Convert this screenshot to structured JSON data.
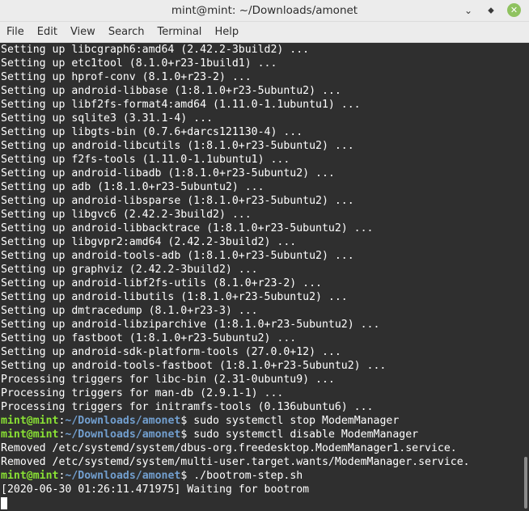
{
  "window": {
    "title": "mint@mint: ~/Downloads/amonet",
    "buttons": {
      "minimize": "⌄",
      "maximize": "⬥",
      "close": "✕"
    }
  },
  "menu": [
    "File",
    "Edit",
    "View",
    "Search",
    "Terminal",
    "Help"
  ],
  "prompt": {
    "user_host": "mint@mint",
    "path": "~/Downloads/amonet",
    "symbol": "$"
  },
  "lines": [
    {
      "type": "out",
      "text": "Setting up libcgraph6:amd64 (2.42.2-3build2) ..."
    },
    {
      "type": "out",
      "text": "Setting up etc1tool (8.1.0+r23-1build1) ..."
    },
    {
      "type": "out",
      "text": "Setting up hprof-conv (8.1.0+r23-2) ..."
    },
    {
      "type": "out",
      "text": "Setting up android-libbase (1:8.1.0+r23-5ubuntu2) ..."
    },
    {
      "type": "out",
      "text": "Setting up libf2fs-format4:amd64 (1.11.0-1.1ubuntu1) ..."
    },
    {
      "type": "out",
      "text": "Setting up sqlite3 (3.31.1-4) ..."
    },
    {
      "type": "out",
      "text": "Setting up libgts-bin (0.7.6+darcs121130-4) ..."
    },
    {
      "type": "out",
      "text": "Setting up android-libcutils (1:8.1.0+r23-5ubuntu2) ..."
    },
    {
      "type": "out",
      "text": "Setting up f2fs-tools (1.11.0-1.1ubuntu1) ..."
    },
    {
      "type": "out",
      "text": "Setting up android-libadb (1:8.1.0+r23-5ubuntu2) ..."
    },
    {
      "type": "out",
      "text": "Setting up adb (1:8.1.0+r23-5ubuntu2) ..."
    },
    {
      "type": "out",
      "text": "Setting up android-libsparse (1:8.1.0+r23-5ubuntu2) ..."
    },
    {
      "type": "out",
      "text": "Setting up libgvc6 (2.42.2-3build2) ..."
    },
    {
      "type": "out",
      "text": "Setting up android-libbacktrace (1:8.1.0+r23-5ubuntu2) ..."
    },
    {
      "type": "out",
      "text": "Setting up libgvpr2:amd64 (2.42.2-3build2) ..."
    },
    {
      "type": "out",
      "text": "Setting up android-tools-adb (1:8.1.0+r23-5ubuntu2) ..."
    },
    {
      "type": "out",
      "text": "Setting up graphviz (2.42.2-3build2) ..."
    },
    {
      "type": "out",
      "text": "Setting up android-libf2fs-utils (8.1.0+r23-2) ..."
    },
    {
      "type": "out",
      "text": "Setting up android-libutils (1:8.1.0+r23-5ubuntu2) ..."
    },
    {
      "type": "out",
      "text": "Setting up dmtracedump (8.1.0+r23-3) ..."
    },
    {
      "type": "out",
      "text": "Setting up android-libziparchive (1:8.1.0+r23-5ubuntu2) ..."
    },
    {
      "type": "out",
      "text": "Setting up fastboot (1:8.1.0+r23-5ubuntu2) ..."
    },
    {
      "type": "out",
      "text": "Setting up android-sdk-platform-tools (27.0.0+12) ..."
    },
    {
      "type": "out",
      "text": "Setting up android-tools-fastboot (1:8.1.0+r23-5ubuntu2) ..."
    },
    {
      "type": "out",
      "text": "Processing triggers for libc-bin (2.31-0ubuntu9) ..."
    },
    {
      "type": "out",
      "text": "Processing triggers for man-db (2.9.1-1) ..."
    },
    {
      "type": "out",
      "text": "Processing triggers for initramfs-tools (0.136ubuntu6) ..."
    },
    {
      "type": "cmd",
      "text": " sudo systemctl stop ModemManager"
    },
    {
      "type": "cmd",
      "text": " sudo systemctl disable ModemManager"
    },
    {
      "type": "out",
      "text": "Removed /etc/systemd/system/dbus-org.freedesktop.ModemManager1.service."
    },
    {
      "type": "out",
      "text": "Removed /etc/systemd/system/multi-user.target.wants/ModemManager.service."
    },
    {
      "type": "cmd",
      "text": " ./bootrom-step.sh"
    },
    {
      "type": "out",
      "text": "[2020-06-30 01:26:11.471975] Waiting for bootrom"
    }
  ],
  "colors": {
    "background": "#2f2f2f",
    "prompt_user": "#8ae234",
    "prompt_path": "#729fcf",
    "text": "#ffffff"
  }
}
